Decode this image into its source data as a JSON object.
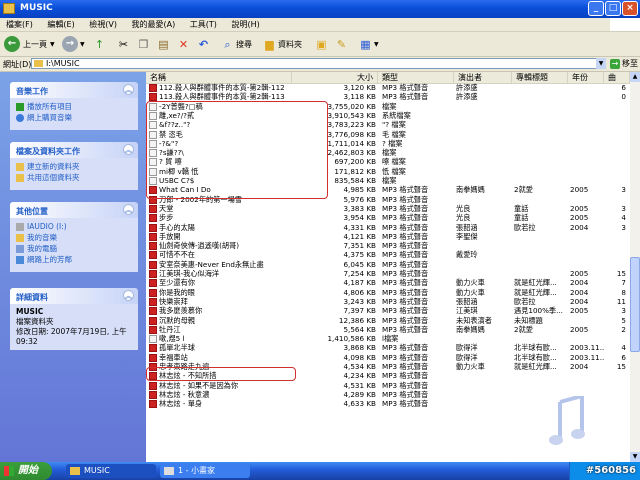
{
  "window": {
    "title": "MUSIC"
  },
  "menu": [
    "檔案(F)",
    "編輯(E)",
    "檢視(V)",
    "我的最愛(A)",
    "工具(T)",
    "說明(H)"
  ],
  "toolbar": {
    "back": "上一頁",
    "search": "搜尋",
    "folders": "資料夾"
  },
  "address": {
    "label": "網址(D)",
    "value": "I:\\MUSIC",
    "go": "移至"
  },
  "sidebar": {
    "tasks": {
      "title": "音樂工作",
      "items": [
        "播放所有項目",
        "網上購買音樂"
      ]
    },
    "file_tasks": {
      "title": "檔案及資料夾工作",
      "items": [
        "建立新的資料夾",
        "共用這個資料夾"
      ]
    },
    "places": {
      "title": "其他位置",
      "items": [
        "IAUDIO (I:)",
        "我的音樂",
        "我的電腦",
        "網路上的芳鄰"
      ]
    },
    "details": {
      "title": "詳細資料",
      "name": "MUSIC",
      "type": "檔案資料夾",
      "modified": "修改日期: 2007年7月19日, 上午 09:32"
    }
  },
  "columns": [
    "名稱",
    "大小",
    "類型",
    "演出者",
    "專輯標題",
    "年份",
    "曲"
  ],
  "files": [
    {
      "name": "112.殺人與群體事件的本質-第2輯-112",
      "size": "3,120 KB",
      "type": "MP3 格式聲音",
      "artist": "許添盛",
      "album": "",
      "year": "",
      "track": "6",
      "icon": "mp3"
    },
    {
      "name": "113.殺人與群體事件的本質-第2輯-113",
      "size": "3,118 KB",
      "type": "MP3 格式聲音",
      "artist": "許添盛",
      "album": "",
      "year": "",
      "track": "0",
      "icon": "mp3"
    },
    {
      "name": "-2Y普聾?□稿",
      "size": "3,755,020 KB",
      "type": "檔案",
      "artist": "",
      "album": "",
      "year": "",
      "track": "",
      "icon": "txt"
    },
    {
      "name": "離,xe?/?貳",
      "size": "3,910,543 KB",
      "type": "系統檔案",
      "artist": "",
      "album": "",
      "year": "",
      "track": "",
      "icon": "txt"
    },
    {
      "name": "&f??z..\"?",
      "size": "3,783,223 KB",
      "type": "\"? 檔案",
      "artist": "",
      "album": "",
      "year": "",
      "track": "",
      "icon": "txt"
    },
    {
      "name": "禁  恣毛",
      "size": "3,776,098 KB",
      "type": "毛 檔案",
      "artist": "",
      "album": "",
      "year": "",
      "track": "",
      "icon": "txt"
    },
    {
      "name": "-?&\"?",
      "size": "1,711,014 KB",
      "type": "? 檔案",
      "artist": "",
      "album": "",
      "year": "",
      "track": "",
      "icon": "txt"
    },
    {
      "name": "?s謙??\\",
      "size": "2,462,803 KB",
      "type": "檔案",
      "artist": "",
      "album": "",
      "year": "",
      "track": "",
      "icon": "txt"
    },
    {
      "name": "?  貿  嚓",
      "size": "697,200 KB",
      "type": "嚓 檔案",
      "artist": "",
      "album": "",
      "year": "",
      "track": "",
      "icon": "txt"
    },
    {
      "name": "mi楖  v轎 忯",
      "size": "171,812 KB",
      "type": "忯 檔案",
      "artist": "",
      "album": "",
      "year": "",
      "track": "",
      "icon": "txt"
    },
    {
      "name": "USBC  C?$",
      "size": "835,584 KB",
      "type": "檔案",
      "artist": "",
      "album": "",
      "year": "",
      "track": "",
      "icon": "txt"
    },
    {
      "name": "What Can I Do",
      "size": "4,985 KB",
      "type": "MP3 格式聲音",
      "artist": "南拳媽媽",
      "album": "2就愛",
      "year": "2005",
      "track": "3",
      "icon": "mp3"
    },
    {
      "name": "刀郎 - 2002年的第一場雪",
      "size": "5,976 KB",
      "type": "MP3 格式聲音",
      "artist": "",
      "album": "",
      "year": "",
      "track": "",
      "icon": "mp3"
    },
    {
      "name": "天堂",
      "size": "3,383 KB",
      "type": "MP3 格式聲音",
      "artist": "光良",
      "album": "童話",
      "year": "2005",
      "track": "3",
      "icon": "mp3"
    },
    {
      "name": "步步",
      "size": "3,954 KB",
      "type": "MP3 格式聲音",
      "artist": "光良",
      "album": "童話",
      "year": "2005",
      "track": "4",
      "icon": "mp3"
    },
    {
      "name": "手心的太陽",
      "size": "4,331 KB",
      "type": "MP3 格式聲音",
      "artist": "張韶涵",
      "album": "歐若拉",
      "year": "2004",
      "track": "3",
      "icon": "mp3"
    },
    {
      "name": "手放開",
      "size": "4,121 KB",
      "type": "MP3 格式聲音",
      "artist": "李聖傑",
      "album": "",
      "year": "",
      "track": "",
      "icon": "mp3"
    },
    {
      "name": "仙劍奇俠傳-逍遙嘆(胡哥)",
      "size": "7,351 KB",
      "type": "MP3 格式聲音",
      "artist": "",
      "album": "",
      "year": "",
      "track": "",
      "icon": "mp3"
    },
    {
      "name": "可惜不不在",
      "size": "4,375 KB",
      "type": "MP3 格式聲音",
      "artist": "戴愛玲",
      "album": "",
      "year": "",
      "track": "",
      "icon": "mp3"
    },
    {
      "name": "安室奈美惠-Never End永無止盡",
      "size": "6,045 KB",
      "type": "MP3 格式聲音",
      "artist": "",
      "album": "",
      "year": "",
      "track": "",
      "icon": "mp3"
    },
    {
      "name": "江美琪-我心似海洋",
      "size": "7,254 KB",
      "type": "MP3 格式聲音",
      "artist": "",
      "album": "",
      "year": "2005",
      "track": "15",
      "icon": "mp3"
    },
    {
      "name": "至少還有你",
      "size": "4,187 KB",
      "type": "MP3 格式聲音",
      "artist": "動力火車",
      "album": "就是紅光輝...",
      "year": "2004",
      "track": "7",
      "icon": "mp3"
    },
    {
      "name": "你是我的眼",
      "size": "4,806 KB",
      "type": "MP3 格式聲音",
      "artist": "動力火車",
      "album": "就是紅光輝...",
      "year": "2004",
      "track": "8",
      "icon": "mp3"
    },
    {
      "name": "快樂崇拜",
      "size": "3,243 KB",
      "type": "MP3 格式聲音",
      "artist": "張韶涵",
      "album": "歐若拉",
      "year": "2004",
      "track": "11",
      "icon": "mp3"
    },
    {
      "name": "我多麼羨慕你",
      "size": "7,397 KB",
      "type": "MP3 格式聲音",
      "artist": "江美琪",
      "album": "遇見100%季...",
      "year": "2005",
      "track": "3",
      "icon": "mp3"
    },
    {
      "name": "沉默的母親",
      "size": "12,386 KB",
      "type": "MP3 格式聲音",
      "artist": "未知表演者",
      "album": "未知標題",
      "year": "",
      "track": "5",
      "icon": "mp3"
    },
    {
      "name": "牡丹江",
      "size": "5,564 KB",
      "type": "MP3 格式聲音",
      "artist": "南拳媽媽",
      "album": "2就愛",
      "year": "2005",
      "track": "2",
      "icon": "mp3"
    },
    {
      "name": "嗽,煜5   l",
      "size": "1,410,586 KB",
      "type": "l檔案",
      "artist": "",
      "album": "",
      "year": "",
      "track": "",
      "icon": "txt"
    },
    {
      "name": "孤單北半球",
      "size": "3,868 KB",
      "type": "MP3 格式聲音",
      "artist": "歐得洋",
      "album": "北半球有歐...",
      "year": "2003.11...",
      "track": "4",
      "icon": "mp3"
    },
    {
      "name": "幸福車站",
      "size": "4,098 KB",
      "type": "MP3 格式聲音",
      "artist": "歐得洋",
      "album": "北半球有歐...",
      "year": "2003.11...",
      "track": "6",
      "icon": "mp3"
    },
    {
      "name": "忠孝東路走九遍",
      "size": "4,534 KB",
      "type": "MP3 格式聲音",
      "artist": "動力火車",
      "album": "就是紅光輝...",
      "year": "2004",
      "track": "15",
      "icon": "mp3"
    },
    {
      "name": "林志炫 - 不知所措",
      "size": "4,234 KB",
      "type": "MP3 格式聲音",
      "artist": "",
      "album": "",
      "year": "",
      "track": "",
      "icon": "mp3"
    },
    {
      "name": "林志炫 - 如果不是因為你",
      "size": "4,531 KB",
      "type": "MP3 格式聲音",
      "artist": "",
      "album": "",
      "year": "",
      "track": "",
      "icon": "mp3"
    },
    {
      "name": "林志炫 - 秋意濃",
      "size": "4,289 KB",
      "type": "MP3 格式聲音",
      "artist": "",
      "album": "",
      "year": "",
      "track": "",
      "icon": "mp3"
    },
    {
      "name": "林志炫 - 單身",
      "size": "4,633 KB",
      "type": "MP3 格式聲音",
      "artist": "",
      "album": "",
      "year": "",
      "track": "",
      "icon": "mp3"
    }
  ],
  "taskbar": {
    "start": "開始",
    "tasks": [
      "MUSIC",
      "1 - 小畫家"
    ]
  },
  "watermark": "#560856",
  "colors": {
    "title": "#0a4fd8",
    "sidebar": "#7ba2e7",
    "highlight": "#d03030",
    "taskbar": "#245edb"
  }
}
